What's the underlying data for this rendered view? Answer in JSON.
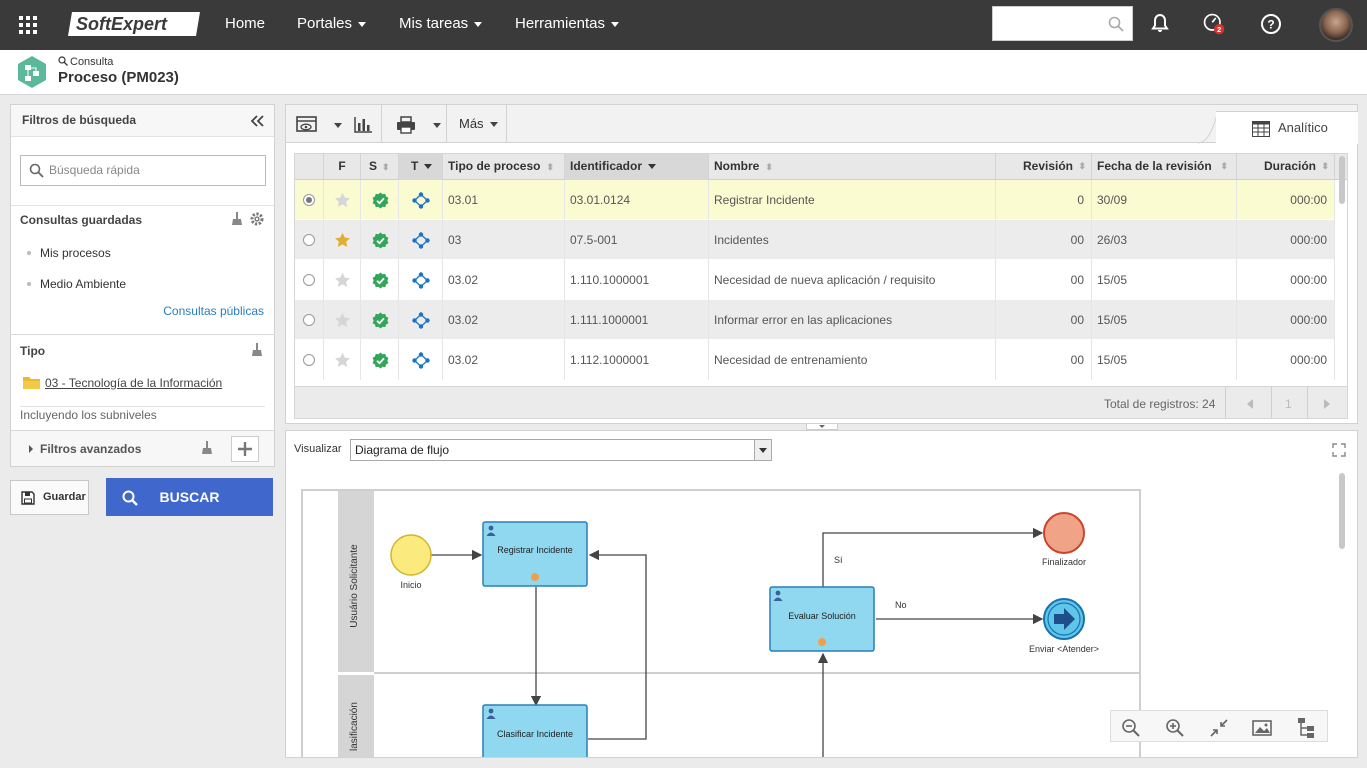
{
  "topbar": {
    "brand": "SoftExpert",
    "nav": [
      {
        "label": "Home"
      },
      {
        "label": "Portales"
      },
      {
        "label": "Mis tareas"
      },
      {
        "label": "Herramientas"
      }
    ],
    "badge_count": "2"
  },
  "header": {
    "breadcrumb": "Consulta",
    "title": "Proceso (PM023)"
  },
  "left": {
    "title": "Filtros de búsqueda",
    "quick_search_placeholder": "Búsqueda rápida",
    "saved_title": "Consultas guardadas",
    "saved_items": [
      "Mis procesos",
      "Medio Ambiente"
    ],
    "public_link": "Consultas públicas",
    "tipo_title": "Tipo",
    "tipo_value": "03 - Tecnología de la Información",
    "subniveles": "Incluyendo los subniveles",
    "advanced": "Filtros avanzados",
    "save_btn": "Guardar",
    "search_btn": "BUSCAR"
  },
  "toolbar": {
    "mas": "Más",
    "tab": "Analítico"
  },
  "table": {
    "headers": [
      "F",
      "S",
      "T",
      "Tipo de proceso",
      "Identificador",
      "Nombre",
      "Revisión",
      "Fecha de la revisión",
      "Duración"
    ],
    "rows": [
      {
        "selected": true,
        "fav": false,
        "tipo": "03.01",
        "id": "03.01.0124",
        "nombre": "Registrar Incidente",
        "rev": "0",
        "fecha": "30/09",
        "dur": "000:00"
      },
      {
        "selected": false,
        "fav": true,
        "tipo": "03",
        "id": "07.5-001",
        "nombre": "Incidentes",
        "rev": "00",
        "fecha": "26/03",
        "dur": "000:00"
      },
      {
        "selected": false,
        "fav": false,
        "tipo": "03.02",
        "id": "1.110.1000001",
        "nombre": "Necesidad de nueva aplicación / requisito",
        "rev": "00",
        "fecha": "15/05",
        "dur": "000:00"
      },
      {
        "selected": false,
        "fav": false,
        "tipo": "03.02",
        "id": "1.111.1000001",
        "nombre": "Informar error en las aplicaciones",
        "rev": "00",
        "fecha": "15/05",
        "dur": "000:00"
      },
      {
        "selected": false,
        "fav": false,
        "tipo": "03.02",
        "id": "1.112.1000001",
        "nombre": "Necesidad de entrenamiento",
        "rev": "00",
        "fecha": "15/05",
        "dur": "000:00"
      }
    ],
    "total": "Total de registros: 24",
    "page": "1"
  },
  "viewer": {
    "label": "Visualizar",
    "selected": "Diagrama de flujo",
    "lanes": [
      "Usuário Solicitante",
      "lasificación"
    ],
    "nodes": {
      "inicio": "Inicio",
      "registrar": "Registrar Incidente",
      "clasificar": "Clasificar Incidente",
      "evaluar": "Evaluar Solución",
      "finalizador": "Finalizador",
      "enviar": "Enviar <Atender>",
      "si": "Sí",
      "no": "No"
    }
  },
  "colors": {
    "topbar": "#3a3a3a",
    "accent": "#3f67cc",
    "selected_row": "#fbfbd2",
    "task_fill": "#8fd8ef",
    "task_stroke": "#2b7fb8"
  }
}
